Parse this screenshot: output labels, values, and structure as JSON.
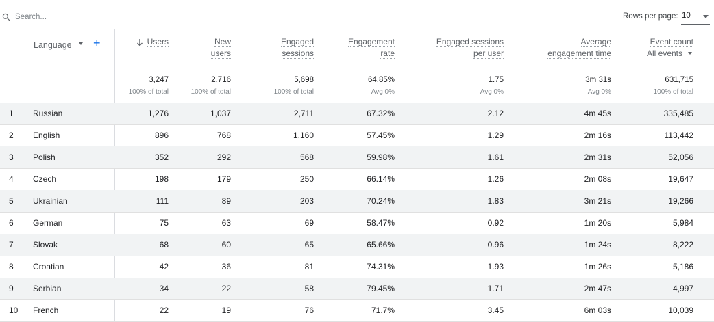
{
  "search": {
    "placeholder": "Search..."
  },
  "pagination": {
    "rows_per_page_label": "Rows per page:",
    "rows_per_page_value": "10"
  },
  "dimension": {
    "label": "Language",
    "add_icon": "plus-icon"
  },
  "columns": [
    {
      "key": "users",
      "line1": "Users",
      "line2": "",
      "sorted": true
    },
    {
      "key": "new_users",
      "line1": "New",
      "line2": "users"
    },
    {
      "key": "engaged_sessions",
      "line1": "Engaged",
      "line2": "sessions"
    },
    {
      "key": "engagement_rate",
      "line1": "Engagement",
      "line2": "rate"
    },
    {
      "key": "engaged_per_user",
      "line1": "Engaged sessions",
      "line2": "per user"
    },
    {
      "key": "avg_engagement_time",
      "line1": "Average",
      "line2": "engagement time"
    },
    {
      "key": "event_count",
      "line1": "Event count",
      "line2": "All events"
    }
  ],
  "totals": [
    {
      "value": "3,247",
      "sub": "100% of total"
    },
    {
      "value": "2,716",
      "sub": "100% of total"
    },
    {
      "value": "5,698",
      "sub": "100% of total"
    },
    {
      "value": "64.85%",
      "sub": "Avg 0%"
    },
    {
      "value": "1.75",
      "sub": "Avg 0%"
    },
    {
      "value": "3m 31s",
      "sub": "Avg 0%"
    },
    {
      "value": "631,715",
      "sub": "100% of total"
    }
  ],
  "rows": [
    {
      "idx": "1",
      "lang": "Russian",
      "cells": [
        "1,276",
        "1,037",
        "2,711",
        "67.32%",
        "2.12",
        "4m 45s",
        "335,485"
      ]
    },
    {
      "idx": "2",
      "lang": "English",
      "cells": [
        "896",
        "768",
        "1,160",
        "57.45%",
        "1.29",
        "2m 16s",
        "113,442"
      ]
    },
    {
      "idx": "3",
      "lang": "Polish",
      "cells": [
        "352",
        "292",
        "568",
        "59.98%",
        "1.61",
        "2m 31s",
        "52,056"
      ]
    },
    {
      "idx": "4",
      "lang": "Czech",
      "cells": [
        "198",
        "179",
        "250",
        "66.14%",
        "1.26",
        "2m 08s",
        "19,647"
      ]
    },
    {
      "idx": "5",
      "lang": "Ukrainian",
      "cells": [
        "111",
        "89",
        "203",
        "70.24%",
        "1.83",
        "3m 21s",
        "19,266"
      ]
    },
    {
      "idx": "6",
      "lang": "German",
      "cells": [
        "75",
        "63",
        "69",
        "58.47%",
        "0.92",
        "1m 20s",
        "5,984"
      ]
    },
    {
      "idx": "7",
      "lang": "Slovak",
      "cells": [
        "68",
        "60",
        "65",
        "65.66%",
        "0.96",
        "1m 24s",
        "8,222"
      ]
    },
    {
      "idx": "8",
      "lang": "Croatian",
      "cells": [
        "42",
        "36",
        "81",
        "74.31%",
        "1.93",
        "1m 26s",
        "5,186"
      ]
    },
    {
      "idx": "9",
      "lang": "Serbian",
      "cells": [
        "34",
        "22",
        "58",
        "79.45%",
        "1.71",
        "2m 47s",
        "4,997"
      ]
    },
    {
      "idx": "10",
      "lang": "French",
      "cells": [
        "22",
        "19",
        "76",
        "71.7%",
        "3.45",
        "6m 03s",
        "10,039"
      ]
    }
  ],
  "colors": {
    "accent": "#1a73e8",
    "row_alt": "#f1f3f4",
    "border": "#dadce0",
    "muted": "#5f6368"
  }
}
